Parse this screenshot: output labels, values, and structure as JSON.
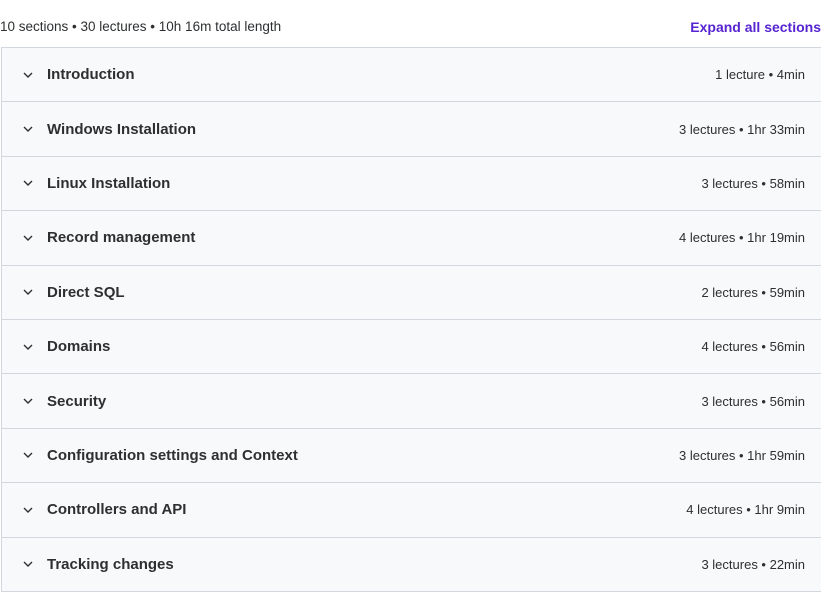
{
  "header": {
    "summary": "10 sections • 30 lectures • 10h 16m total length",
    "expand_label": "Expand all sections"
  },
  "sections": [
    {
      "title": "Introduction",
      "meta": "1 lecture • 4min"
    },
    {
      "title": "Windows Installation",
      "meta": "3 lectures • 1hr 33min"
    },
    {
      "title": "Linux Installation",
      "meta": "3 lectures • 58min"
    },
    {
      "title": "Record management",
      "meta": "4 lectures • 1hr 19min"
    },
    {
      "title": "Direct SQL",
      "meta": "2 lectures • 59min"
    },
    {
      "title": "Domains",
      "meta": "4 lectures • 56min"
    },
    {
      "title": "Security",
      "meta": "3 lectures • 56min"
    },
    {
      "title": "Configuration settings and Context",
      "meta": "3 lectures • 1hr 59min"
    },
    {
      "title": "Controllers and API",
      "meta": "4 lectures • 1hr 9min"
    },
    {
      "title": "Tracking changes",
      "meta": "3 lectures • 22min"
    }
  ],
  "colors": {
    "accent": "#5624d0",
    "section_bg": "#f7f9fa",
    "border": "#d1d7dc"
  },
  "icons": {
    "section_toggle": "chevron-down-icon"
  }
}
